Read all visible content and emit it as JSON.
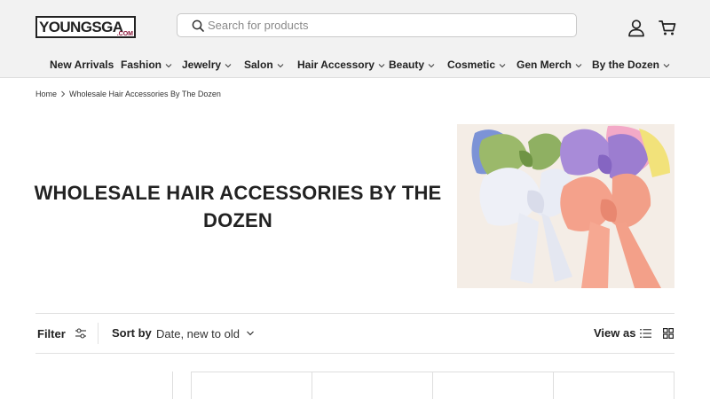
{
  "header": {
    "logo": {
      "main": "YOUNGSGA",
      "tld": ".COM"
    },
    "search": {
      "placeholder": "Search for products"
    },
    "icons": [
      "search-icon",
      "account-icon",
      "cart-icon"
    ]
  },
  "nav": {
    "items": [
      {
        "label": "New Arrivals",
        "has_dropdown": false
      },
      {
        "label": "Fashion",
        "has_dropdown": true
      },
      {
        "label": "Jewelry",
        "has_dropdown": true
      },
      {
        "label": "Salon",
        "has_dropdown": true
      },
      {
        "label": "Hair Accessory",
        "has_dropdown": true
      },
      {
        "label": "Beauty",
        "has_dropdown": true
      },
      {
        "label": "Cosmetic",
        "has_dropdown": true
      },
      {
        "label": "Gen Merch",
        "has_dropdown": true
      },
      {
        "label": "By the Dozen",
        "has_dropdown": true
      }
    ]
  },
  "breadcrumb": {
    "home": "Home",
    "current": "Wholesale Hair Accessories By The Dozen"
  },
  "hero": {
    "title": "WHOLESALE HAIR ACCESSORIES BY THE DOZEN",
    "image_subject": "assorted fabric hair bows"
  },
  "toolbar": {
    "filter_label": "Filter",
    "sort_label": "Sort by",
    "sort_value": "Date, new to old",
    "view_label": "View as"
  },
  "colors": {
    "header_bg": "#f2f2f2",
    "logo_accent": "#8a1538",
    "text": "#222222",
    "border": "#dedede"
  }
}
